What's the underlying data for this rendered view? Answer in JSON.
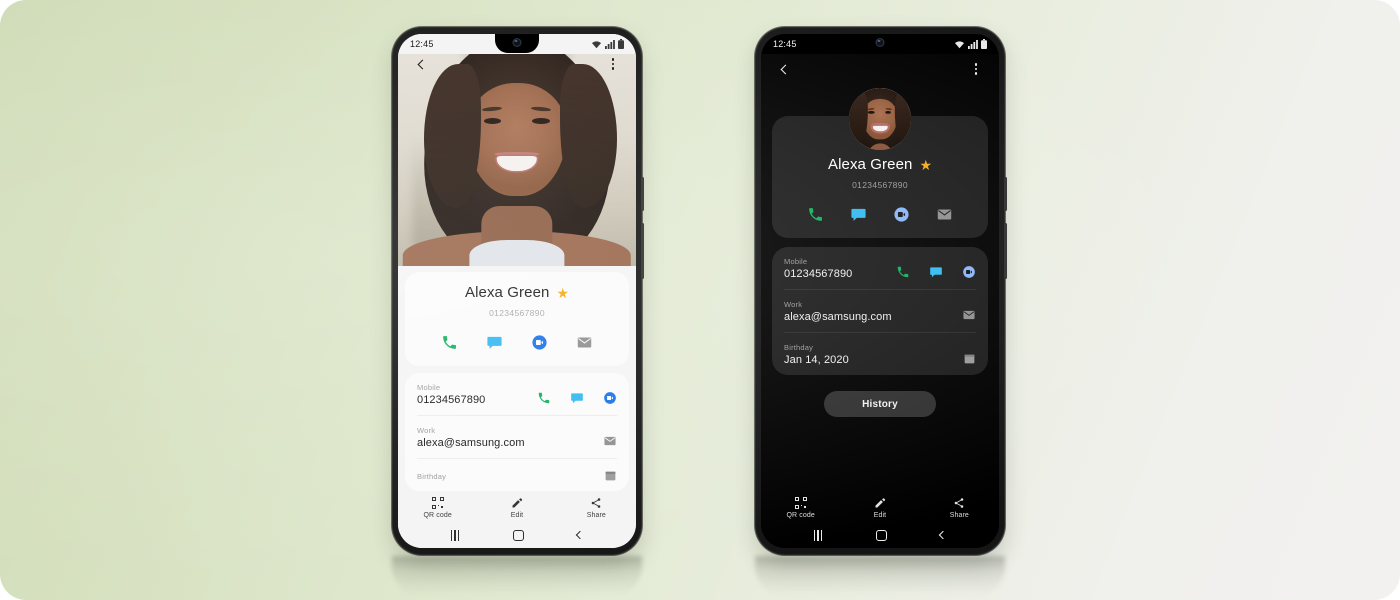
{
  "background": {
    "gradient_from": "#cfdcb7",
    "gradient_to": "#f2f1f0"
  },
  "phones": [
    {
      "id": "left-phone-light-theme",
      "theme": "light",
      "status_bar": {
        "time": "12:45",
        "wifi": "wifi-icon",
        "signal": "signal-icon",
        "battery": "battery-icon"
      },
      "app_bar": {
        "back": "back-icon",
        "more": "more-options-icon"
      },
      "hero": {
        "type": "contact-photo"
      },
      "contact": {
        "name": "Alexa Green",
        "favorite": true,
        "favorite_color": "#f5aa14",
        "phone": "01234567890",
        "actions": [
          {
            "name": "call-action",
            "icon": "phone-icon",
            "color": "#12b15c"
          },
          {
            "name": "message-action",
            "icon": "message-icon",
            "color": "#33b9f0"
          },
          {
            "name": "video-call-action",
            "icon": "video-call-icon",
            "color": "#1a73e8"
          },
          {
            "name": "email-action",
            "icon": "email-icon",
            "color": "#8f8f8f"
          }
        ]
      },
      "fields": [
        {
          "label": "Mobile",
          "value": "01234567890",
          "icons": [
            "phone-icon",
            "message-icon",
            "video-call-icon"
          ]
        },
        {
          "label": "Work",
          "value": "alexa@samsung.com",
          "icons": [
            "email-icon"
          ]
        },
        {
          "label": "Birthday",
          "value": "",
          "icons": [
            "calendar-icon"
          ]
        }
      ],
      "bottom_actions": [
        {
          "label": "QR code",
          "icon": "qr-code-icon"
        },
        {
          "label": "Edit",
          "icon": "pencil-icon"
        },
        {
          "label": "Share",
          "icon": "share-icon"
        }
      ],
      "nav_bar": {
        "recents": "recents-icon",
        "home": "home-icon",
        "back": "back-icon"
      }
    },
    {
      "id": "right-phone-dark-theme",
      "theme": "dark",
      "status_bar": {
        "time": "12:45",
        "wifi": "wifi-icon",
        "signal": "signal-icon",
        "battery": "battery-icon"
      },
      "app_bar": {
        "back": "back-icon",
        "more": "more-options-icon"
      },
      "contact": {
        "name": "Alexa Green",
        "favorite": true,
        "favorite_color": "#f5aa14",
        "phone": "01234567890",
        "actions": [
          {
            "name": "call-action",
            "icon": "phone-icon",
            "color": "#12b15c"
          },
          {
            "name": "message-action",
            "icon": "message-icon",
            "color": "#33b9f0"
          },
          {
            "name": "video-call-action",
            "icon": "video-call-icon",
            "color": "#8ab4f8"
          },
          {
            "name": "email-action",
            "icon": "email-icon",
            "color": "#8f8f8f"
          }
        ]
      },
      "fields": [
        {
          "label": "Mobile",
          "value": "01234567890",
          "icons": [
            "phone-icon",
            "message-icon",
            "video-call-icon"
          ]
        },
        {
          "label": "Work",
          "value": "alexa@samsung.com",
          "icons": [
            "email-icon"
          ]
        },
        {
          "label": "Birthday",
          "value": "Jan 14, 2020",
          "icons": [
            "calendar-icon"
          ]
        }
      ],
      "history_button": "History",
      "bottom_actions": [
        {
          "label": "QR code",
          "icon": "qr-code-icon"
        },
        {
          "label": "Edit",
          "icon": "pencil-icon"
        },
        {
          "label": "Share",
          "icon": "share-icon"
        }
      ],
      "nav_bar": {
        "recents": "recents-icon",
        "home": "home-icon",
        "back": "back-icon"
      }
    }
  ]
}
